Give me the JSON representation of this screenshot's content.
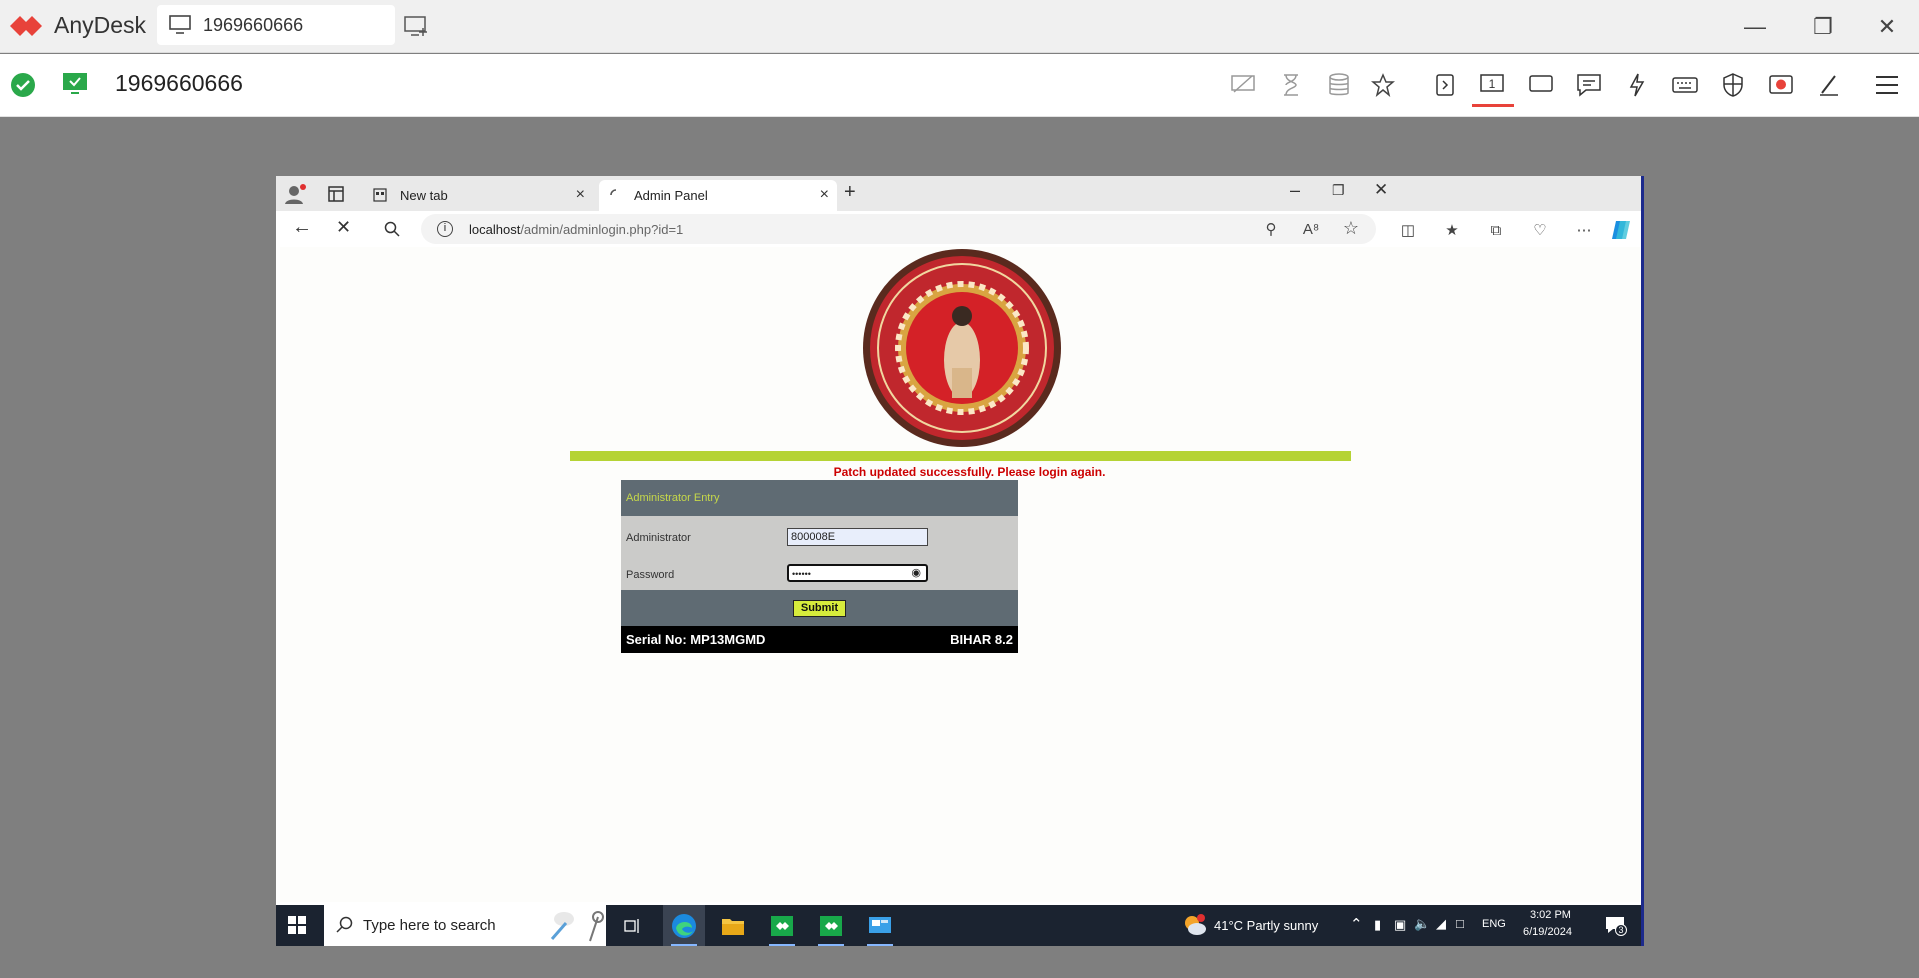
{
  "anydesk": {
    "app_name": "AnyDesk",
    "tab_id": "1969660666",
    "address": "1969660666",
    "brand_color": "#e8423a"
  },
  "browser": {
    "tabs": [
      {
        "label": "New tab"
      },
      {
        "label": "Admin Panel"
      }
    ],
    "url_host": "localhost",
    "url_path": "/admin/adminlogin.php?id=1"
  },
  "page": {
    "status_message": "Patch updated successfully. Please login again.",
    "form": {
      "title": "Administrator Entry",
      "admin_label": "Administrator",
      "admin_value": "800008E",
      "password_label": "Password",
      "password_value": "••••••",
      "submit_label": "Submit",
      "serial": "Serial No: MP13MGMD",
      "version": "BIHAR 8.2"
    }
  },
  "taskbar": {
    "search_placeholder": "Type here to search",
    "weather": "41°C  Partly sunny",
    "language": "ENG",
    "time": "3:02 PM",
    "date": "6/19/2024",
    "notification_count": "3"
  }
}
